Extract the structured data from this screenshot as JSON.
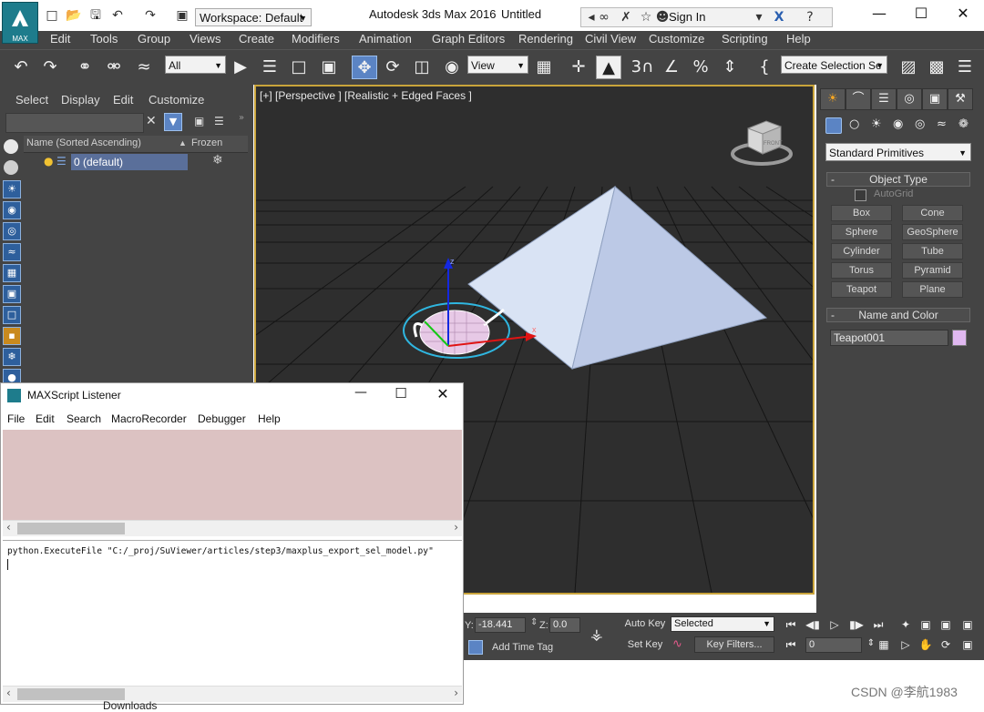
{
  "app": {
    "title": "Autodesk 3ds Max 2016",
    "document": "Untitled",
    "logo_label": "MAX",
    "workspace": "Workspace: Default",
    "sign_in": "Sign In"
  },
  "menubar": [
    "Edit",
    "Tools",
    "Group",
    "Views",
    "Create",
    "Modifiers",
    "Animation",
    "Graph Editors",
    "Rendering",
    "Civil View",
    "Customize",
    "Scripting",
    "Help"
  ],
  "toolbar": {
    "selection_filter": "All",
    "reference_coord": "View",
    "named_selection_placeholder": "Create Selection Se"
  },
  "scene_explorer": {
    "tabs": [
      "Select",
      "Display",
      "Edit",
      "Customize"
    ],
    "columns": [
      "Name (Sorted Ascending)",
      "Frozen"
    ],
    "rows": [
      {
        "name": "0 (default)"
      }
    ]
  },
  "viewport": {
    "label": "[+] [Perspective ] [Realistic + Edged Faces ]",
    "viewcube_label": "FRONT"
  },
  "command_panel": {
    "category": "Standard Primitives",
    "object_type_title": "Object Type",
    "autogrid_label": "AutoGrid",
    "buttons": [
      "Box",
      "Cone",
      "Sphere",
      "GeoSphere",
      "Cylinder",
      "Tube",
      "Torus",
      "Pyramid",
      "Teapot",
      "Plane"
    ],
    "name_color_title": "Name and Color",
    "object_name": "Teapot001",
    "object_color": "#e0b8f0"
  },
  "bottom": {
    "y_label": "Y:",
    "y_value": "-18.441",
    "z_label": "Z:",
    "z_value": "0.0",
    "auto_key": "Auto Key",
    "set_key": "Set Key",
    "key_mode": "Selected",
    "key_filters": "Key Filters...",
    "add_time_tag": "Add Time Tag",
    "frame": "0"
  },
  "listener": {
    "title": "MAXScript Listener",
    "menu": [
      "File",
      "Edit",
      "Search",
      "MacroRecorder",
      "Debugger",
      "Help"
    ],
    "command": "python.ExecuteFile \"C:/_proj/SuViewer/articles/step3/maxplus_export_sel_model.py\""
  },
  "taskbar": {
    "downloads": "Downloads"
  },
  "watermark": "CSDN @李航1983",
  "colors": {
    "ui_dark": "#444444",
    "viewport_bg": "#2e2e2e",
    "viewport_border": "#c9a43b",
    "listener_output_bg": "#dcc2c2",
    "pyramid": "#c8d6ee",
    "selection_row": "#5a6f9a"
  }
}
